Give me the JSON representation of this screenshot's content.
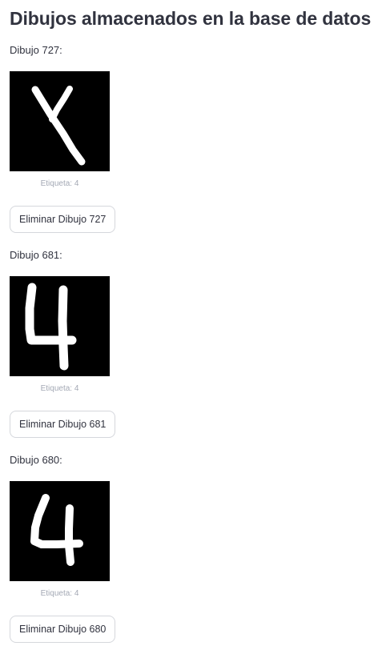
{
  "header": {
    "title": "Dibujos almacenados en la base de datos"
  },
  "drawings": [
    {
      "label": "Dibujo 727:",
      "caption": "Etiqueta: 4",
      "button_label": "Eliminar Dibujo 727"
    },
    {
      "label": "Dibujo 681:",
      "caption": "Etiqueta: 4",
      "button_label": "Eliminar Dibujo 681"
    },
    {
      "label": "Dibujo 680:",
      "caption": "Etiqueta: 4",
      "button_label": "Eliminar Dibujo 680"
    }
  ],
  "colors": {
    "text": "#31333f",
    "caption": "#a3a8b4",
    "button_border": "#d5d7dc",
    "image_background": "#000000",
    "stroke": "#ffffff"
  }
}
